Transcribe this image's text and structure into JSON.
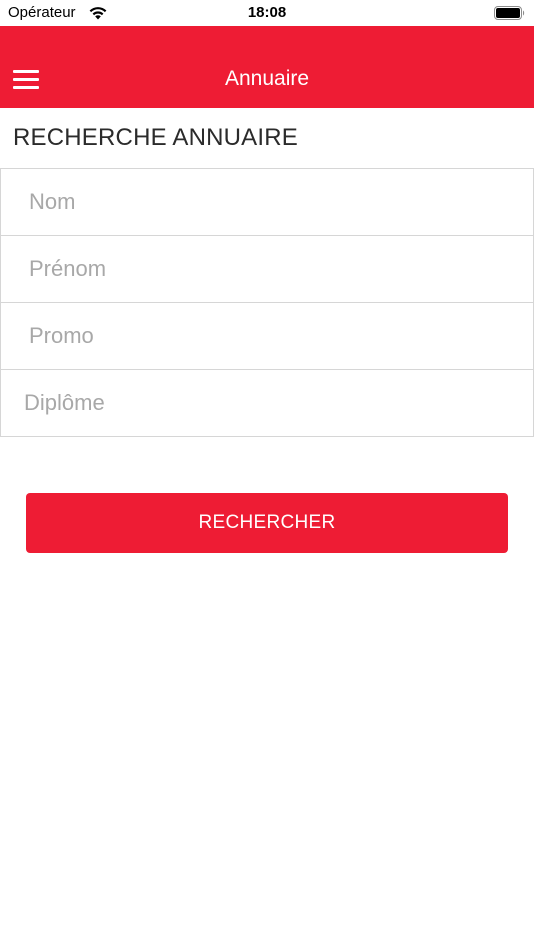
{
  "status_bar": {
    "carrier": "Opérateur",
    "time": "18:08",
    "wifi_icon": "wifi-icon",
    "battery_icon": "battery-icon"
  },
  "navbar": {
    "title": "Annuaire",
    "menu_icon": "hamburger-menu-icon",
    "background_color": "#ee1c34"
  },
  "search": {
    "section_title": "RECHERCHE ANNUAIRE",
    "fields": {
      "nom_placeholder": "Nom",
      "prenom_placeholder": "Prénom",
      "promo_placeholder": "Promo",
      "diplome_placeholder": "Diplôme"
    },
    "button_label": "RECHERCHER"
  },
  "colors": {
    "accent": "#ee1c34",
    "placeholder": "#a8a8a8",
    "border": "#d6d6d6"
  }
}
